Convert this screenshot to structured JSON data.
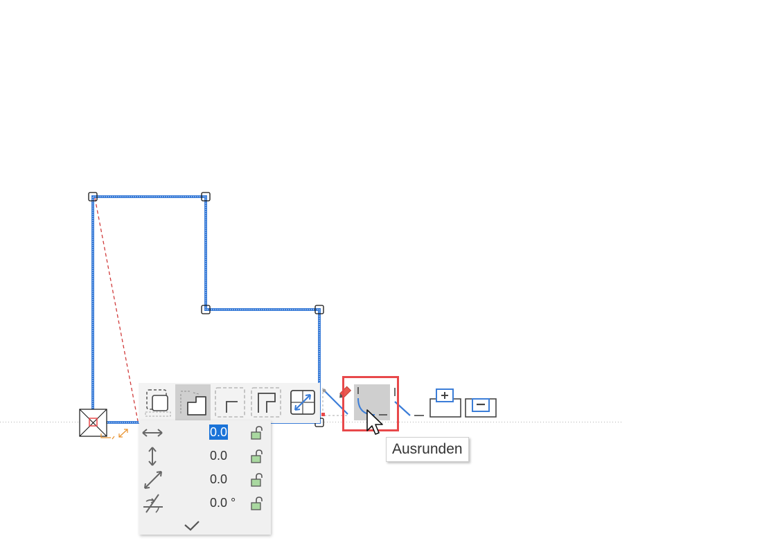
{
  "toolbar": {
    "buttons": [
      {
        "name": "rectangle-select-button",
        "icon": "dashed-square-icon"
      },
      {
        "name": "polygon-corner-button",
        "icon": "polygon-l-icon",
        "pressed": true
      },
      {
        "name": "corner-offset-button",
        "icon": "corner-dashed-icon"
      },
      {
        "name": "corner-rounded-button",
        "icon": "corner-inner-icon"
      },
      {
        "name": "diagonal-split-button",
        "icon": "diagonal-arrow-box-icon"
      },
      {
        "name": "edit-segment-button",
        "icon": "pencil-line-icon"
      },
      {
        "name": "fillet-button",
        "icon": "fillet-arc-icon",
        "highlighted": true
      },
      {
        "name": "chamfer-button",
        "icon": "chamfer-line-icon"
      },
      {
        "name": "add-area-button",
        "icon": "plus-box-icon"
      },
      {
        "name": "subtract-area-button",
        "icon": "minus-box-icon"
      }
    ]
  },
  "tooltip": {
    "text": "Ausrunden"
  },
  "panel": {
    "rows": [
      {
        "name": "dx",
        "icon": "horizontal-arrow-icon",
        "value": "0.0",
        "selected": true
      },
      {
        "name": "dy",
        "icon": "vertical-arrow-icon",
        "value": "0.0"
      },
      {
        "name": "distance",
        "icon": "diagonal-arrow-icon",
        "value": "0.0"
      },
      {
        "name": "angle",
        "icon": "angle-icon",
        "value": "0.0 °"
      }
    ]
  },
  "colors": {
    "outline": "#3b7dd8",
    "accent_red": "#e8484a",
    "panel_bg": "#f0f0f0",
    "selection": "#1a73d8"
  }
}
